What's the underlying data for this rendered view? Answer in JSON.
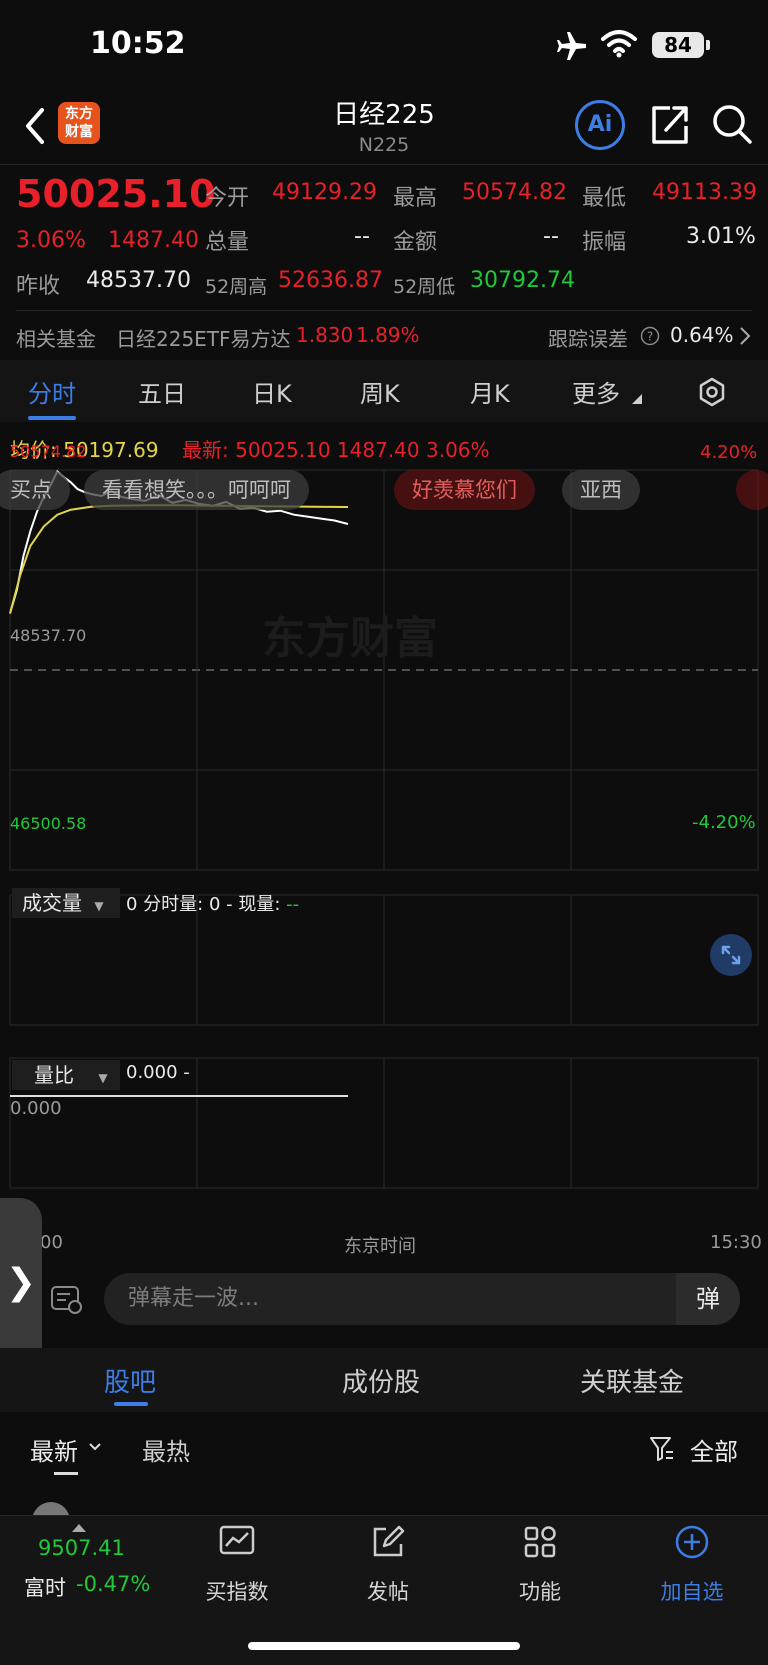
{
  "status": {
    "time": "10:52",
    "battery": "84"
  },
  "nav": {
    "logo_line1": "东方",
    "logo_line2": "财富",
    "title": "日经225",
    "subtitle": "N225",
    "ai_label": "Ai"
  },
  "quote": {
    "price": "50025.10",
    "change_pct": "3.06%",
    "change": "1487.40",
    "open_label": "今开",
    "open": "49129.29",
    "high_label": "最高",
    "high": "50574.82",
    "low_label": "最低",
    "low": "49113.39",
    "volume_label": "总量",
    "volume": "--",
    "amount_label": "金额",
    "amount": "--",
    "amplitude_label": "振幅",
    "amplitude": "3.01%",
    "prev_close_label": "昨收",
    "prev_close": "48537.70",
    "week52_high_label": "52周高",
    "week52_high": "52636.87",
    "week52_low_label": "52周低",
    "week52_low": "30792.74"
  },
  "fund": {
    "label": "相关基金",
    "name": "日经225ETF易方达",
    "price": "1.830",
    "change_pct": "1.89%",
    "tracking_label": "跟踪误差",
    "tracking_value": "0.64%"
  },
  "chart_tabs": [
    "分时",
    "五日",
    "日K",
    "周K",
    "月K",
    "更多"
  ],
  "chart_info": {
    "avg_label": "均价:",
    "avg_value": "50197.69",
    "latest_label": "最新:",
    "latest_value": "50025.10",
    "latest_change": "1487.40",
    "latest_pct": "3.06%",
    "y_top": "50574.82",
    "y_mid": "48537.70",
    "y_bottom": "46500.58",
    "pct_top": "4.20%",
    "pct_bottom": "-4.20%",
    "watermark": "东方财富",
    "volume_dropdown": "成交量",
    "volume_info": "0 分时量: 0 - 现量: ",
    "volume_info_dashes": "--",
    "ratio_dropdown": "量比",
    "ratio_info": "0.000 -",
    "ratio_top": "0.000",
    "ratio_bottom": "00",
    "time_start": "00",
    "time_label": "东京时间",
    "time_end": "15:30"
  },
  "danmu": [
    "买点",
    "看看想笑。。。呵呵呵",
    "好羡慕您们",
    "亚西"
  ],
  "chart_data": {
    "type": "line",
    "title": "",
    "xlabel": "东京时间",
    "ylabel": "",
    "ylim": [
      46500.58,
      50574.82
    ],
    "series": [
      {
        "name": "",
        "x": [
          0,
          2,
          4,
          6,
          8,
          10,
          12,
          14,
          16,
          18,
          20,
          22,
          24,
          27,
          30,
          33,
          36,
          40,
          44,
          48,
          52,
          56,
          60,
          64,
          68,
          72,
          76,
          80,
          84,
          88,
          92,
          96,
          100
        ],
        "values": [
          49113,
          49350,
          49700,
          49950,
          50150,
          50300,
          50420,
          50560,
          50500,
          50450,
          50380,
          50350,
          50330,
          50310,
          50360,
          50300,
          50280,
          50260,
          50320,
          50240,
          50270,
          50230,
          50210,
          50250,
          50180,
          50190,
          50150,
          50160,
          50120,
          50100,
          50080,
          50060,
          50025
        ]
      },
      {
        "name": "均价",
        "x": [
          0,
          3,
          6,
          10,
          14,
          18,
          24,
          30,
          40,
          50,
          60,
          70,
          80,
          90,
          100
        ],
        "values": [
          49113,
          49500,
          49800,
          50000,
          50120,
          50170,
          50200,
          50210,
          50215,
          50215,
          50212,
          50208,
          50204,
          50200,
          50198
        ]
      }
    ]
  },
  "input": {
    "placeholder": "弹幕走一波...",
    "send": "弹"
  },
  "forum_tabs": [
    "股吧",
    "成份股",
    "关联基金"
  ],
  "sort": {
    "latest": "最新",
    "hot": "最热",
    "filter": "全部"
  },
  "bottom": {
    "index_value": "9507.41",
    "index_name": "富时",
    "index_pct": "-0.47%",
    "items": [
      "买指数",
      "发帖",
      "功能",
      "加自选"
    ]
  },
  "colors": {
    "up": "#e8202a",
    "down": "#1fc93a",
    "accent": "#3d7de6",
    "avg_line": "#e3d54a"
  }
}
